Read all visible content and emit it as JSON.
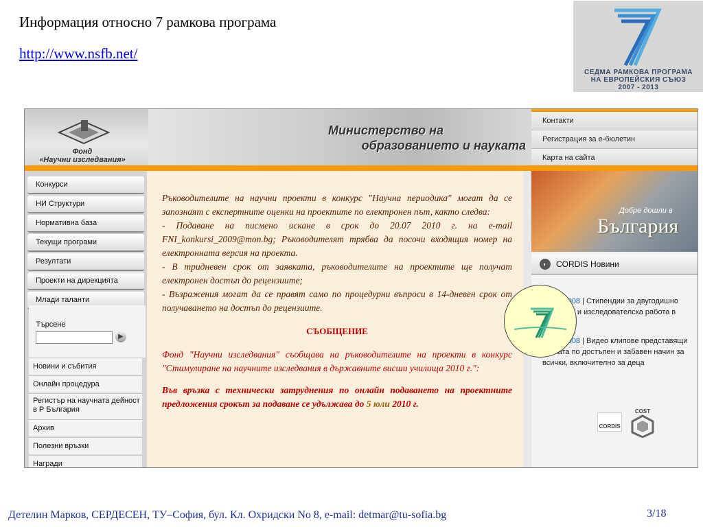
{
  "slide": {
    "title": "Информация относно 7 рамкова програма",
    "link": "http://www.nsfb.net/",
    "fp7_logo": {
      "line1": "СЕДМА РАМКОВА ПРОГРАМА",
      "line2": "НА ЕВРОПЕЙСКИЯ СЪЮЗ",
      "line3": "2007 - 2013"
    },
    "footer": "Детелин Марков, СЕРДЕСЕН, ТУ–София, бул. Кл. Охридски No 8, e-mail: detmar@tu-sofia.bg",
    "page": "3/18"
  },
  "site": {
    "fund_name_line1": "Фонд",
    "fund_name_line2": "«Научни изследвания»",
    "ministry_line1": "Министерство на",
    "ministry_line2": "образованието и науката",
    "header_deco": "volts",
    "top_links": [
      "Контакти",
      "Регистрация за е-бюлетин",
      "Карта на сайта"
    ],
    "nav": [
      "Конкурси",
      "НИ Структури",
      "Нормативна база",
      "Текущи програми",
      "Резултати",
      "Проекти на дирекцията",
      "Млади таланти"
    ],
    "search": {
      "label": "Търсене",
      "go": "▶"
    },
    "sub_links": [
      "Новини и събития",
      "Онлайн процедура",
      "Регистър на научната дейност в Р България",
      "Архив",
      "Полезни връзки",
      "Награди"
    ],
    "content": {
      "p1": "Ръководителите на научни проекти в конкурс \"Научна периодика\" могат да се запознаят с експертните оценки на проектите по електронен път, както следва:",
      "p2": "- Подаване на писмено искане в срок до 20.07 2010 г. на e-mail FNI_konkursi_2009@mon.bg; Ръководителят трябва да посочи входящия номер на електронната версия на проекта.",
      "p3": "- В тридневен срок от заявката, ръководителите на проектите ще получат електронен достъп до рецензиите;",
      "p4": "- Възражения могат да се правят само по процедурни въпроси в 14-дневен срок от получаването на достъп до рецензиите.",
      "msg_title": "СЪОБЩЕНИЕ",
      "msg_body": "Фонд \"Научни изследвания\" съобщава на ръководителите на проекти в конкурс \"Стимулиране на научните изследвания в държавните висши училища 2010 г.\":",
      "notice": "Във връзка с технически затруднения по онлайн подаването на проектните предложения срокът за подаване се удължава до",
      "notice_date": "5 юли",
      "notice_end": "2010 г."
    },
    "banner": {
      "welcome": "Добре дошли в",
      "country": "България"
    },
    "cordis": {
      "title": "CORDIS Новини"
    },
    "news": [
      {
        "date": "20.06.2008",
        "text": "| Стипендии за двугодишно обучение и изследователска работа в Китай"
      },
      {
        "date": "02.06.2008",
        "text": "| Видео клипове представящи науката по достъпен и забавен начин за всички, включително за деца"
      }
    ],
    "partners": {
      "cordis": "CORDIS",
      "cost": "COST"
    }
  }
}
